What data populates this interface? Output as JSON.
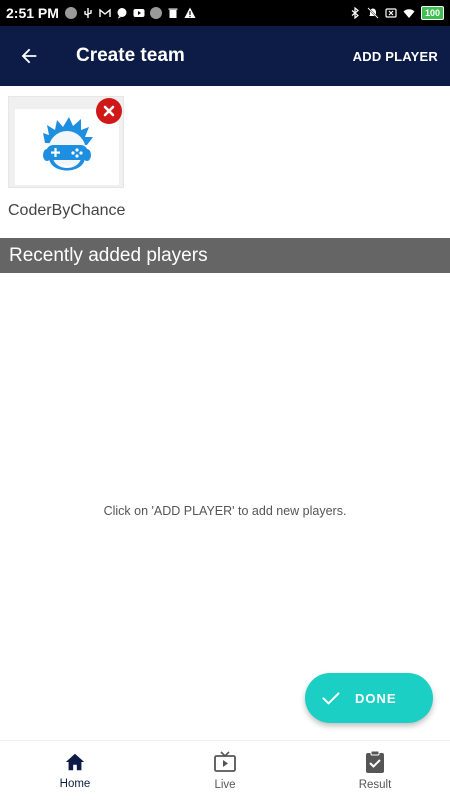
{
  "status_bar": {
    "time": "2:51 PM",
    "battery": "100",
    "left_icons": [
      "circle-icon",
      "usb-icon",
      "gmail-icon",
      "chat-icon",
      "youtube-icon",
      "circle-icon",
      "trash-icon",
      "warning-icon"
    ],
    "right_icons": [
      "bluetooth-icon",
      "mute-icon",
      "no-sim-icon",
      "wifi-icon",
      "battery-icon"
    ]
  },
  "app_bar": {
    "title": "Create team",
    "action_label": "ADD PLAYER",
    "back_icon": "arrow-back-icon"
  },
  "team": {
    "players": [
      {
        "name": "CoderByChance",
        "avatar_icon": "gamer-avatar-icon"
      }
    ]
  },
  "recent_section": {
    "title": "Recently added players",
    "empty_message": "Click on 'ADD PLAYER' to add new players."
  },
  "fab": {
    "label": "DONE",
    "icon": "check-icon"
  },
  "bottom_nav": {
    "items": [
      {
        "label": "Home",
        "icon": "home-icon",
        "active": true
      },
      {
        "label": "Live",
        "icon": "live-tv-icon",
        "active": false
      },
      {
        "label": "Result",
        "icon": "clipboard-check-icon",
        "active": false
      }
    ]
  },
  "colors": {
    "app_bar": "#0c1c46",
    "section_header": "#656565",
    "fab": "#1ccfc4",
    "remove": "#d01818"
  }
}
